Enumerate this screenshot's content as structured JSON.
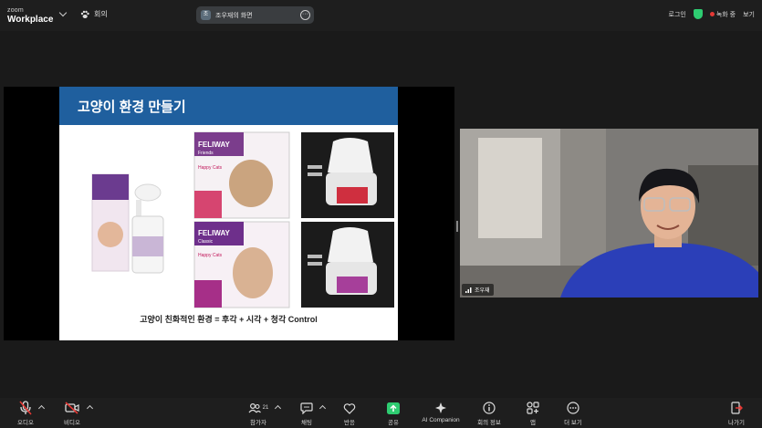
{
  "brand": {
    "line1": "zoom",
    "line2": "Workplace"
  },
  "meeting": {
    "label": "회의"
  },
  "share_pill": {
    "avatar_initial": "조",
    "text": "조우재의 화면"
  },
  "top_right": {
    "login": "로그인",
    "recording": "녹화 중",
    "view": "보기"
  },
  "slide": {
    "title": "고양이 환경 만들기",
    "caption": "고양이 친화적인 환경 = 후각 + 시각 + 청각 Control",
    "product_brand": "FELIWAY",
    "product_lines": [
      "Classic",
      "Friends"
    ],
    "product_tag": "Happy Cats"
  },
  "participant": {
    "name": "조우재"
  },
  "toolbar": {
    "audio": "오디오",
    "video": "비디오",
    "participants": "참가자",
    "participants_count": "21",
    "chat": "채팅",
    "reactions": "반응",
    "share": "공유",
    "ai": "AI Companion",
    "info": "회의 정보",
    "apps": "앱",
    "more": "더 보기",
    "leave": "나가기"
  },
  "colors": {
    "slide_header": "#1f5f9e",
    "share_green": "#2ecc71",
    "recording_red": "#e53935",
    "shirt_blue": "#2b3fb8"
  }
}
